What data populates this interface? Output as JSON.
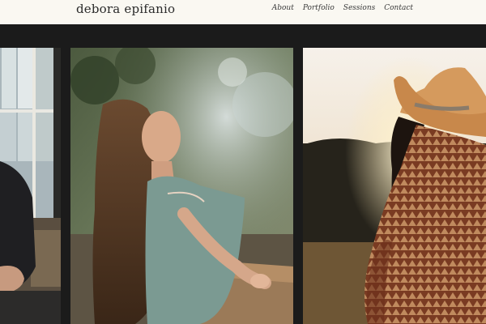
{
  "header": {
    "brand": "debora epifanio",
    "nav": [
      {
        "label": "About"
      },
      {
        "label": "Portfolio"
      },
      {
        "label": "Sessions"
      },
      {
        "label": "Contact"
      }
    ]
  },
  "gallery": {
    "photos": [
      {
        "subject": "man-by-window-photo"
      },
      {
        "subject": "woman-leaning-on-fence-photo"
      },
      {
        "subject": "woman-in-cowboy-hat-sunset-photo"
      }
    ]
  }
}
